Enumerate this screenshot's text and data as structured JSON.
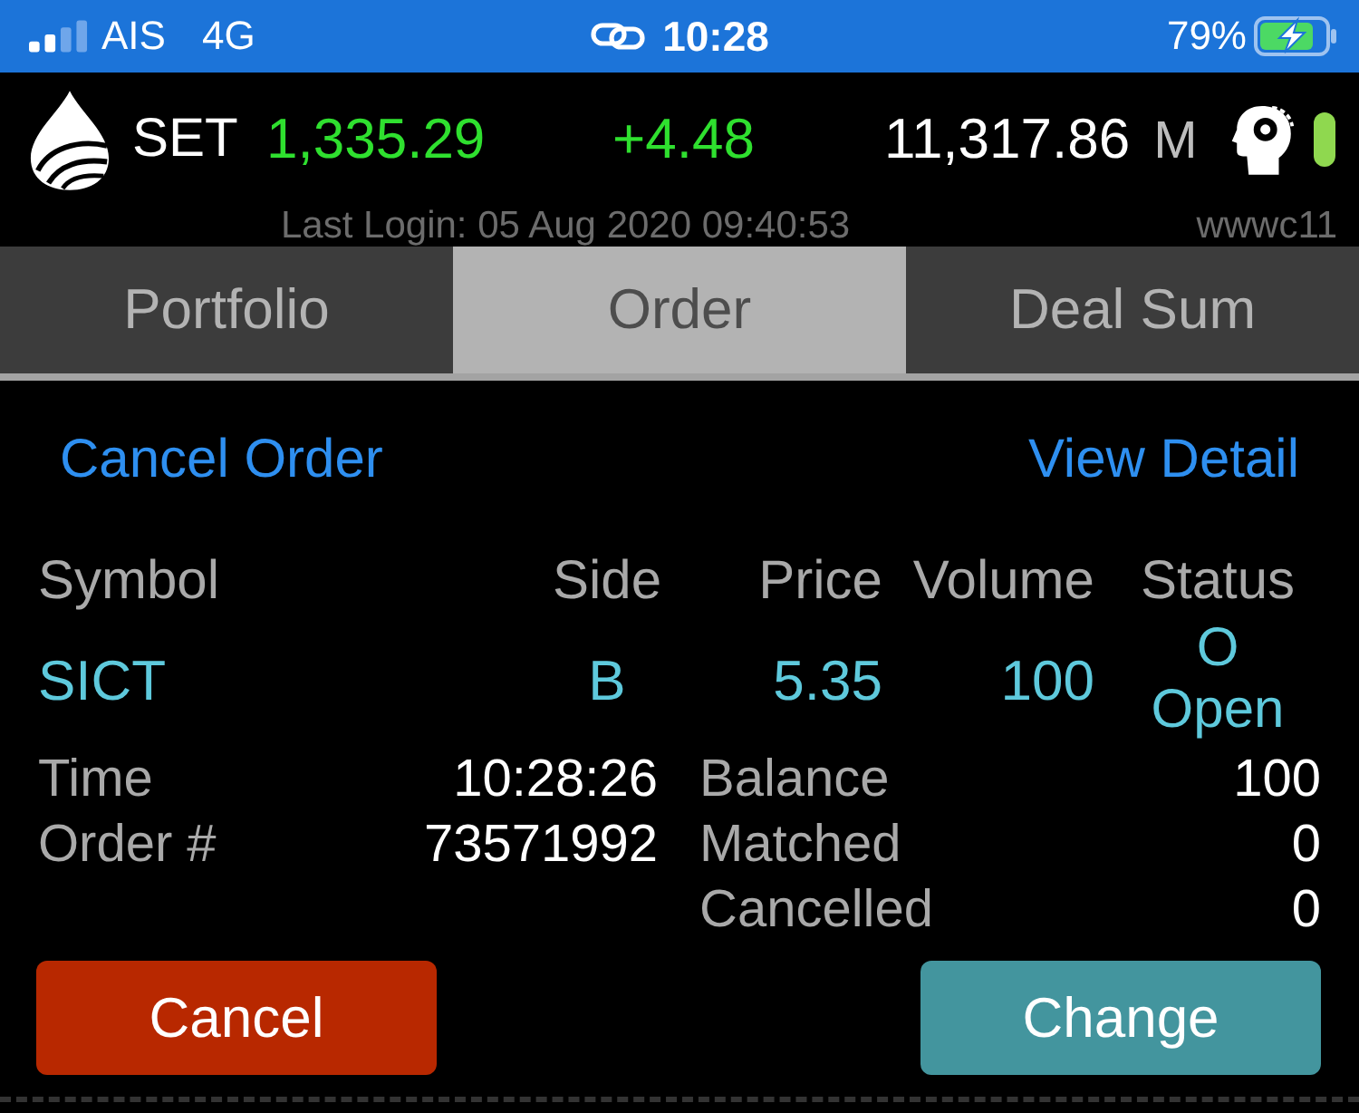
{
  "status_bar": {
    "carrier": "AIS",
    "network": "4G",
    "time": "10:28",
    "battery": "79%",
    "charging": true
  },
  "header": {
    "index_name": "SET",
    "index_value": "1,335.29",
    "change": "+4.48",
    "value": "11,317.86",
    "value_unit": "M",
    "connected": true,
    "last_login": "Last Login: 05 Aug 2020 09:40:53",
    "user": "wwwc11"
  },
  "tabs": [
    {
      "label": "Portfolio",
      "selected": false
    },
    {
      "label": "Order",
      "selected": true
    },
    {
      "label": "Deal Sum",
      "selected": false
    }
  ],
  "links": [
    "Cancel Order",
    "View Detail"
  ],
  "order_table": {
    "columns": [
      "Symbol",
      "Side",
      "Price",
      "Volume",
      "Status"
    ],
    "row": {
      "symbol": "SICT",
      "side": "B",
      "price": "5.35",
      "volume": "100",
      "status_code": "O",
      "status": "Open"
    }
  },
  "details": {
    "left": [
      {
        "label": "Time",
        "value": "10:28:26"
      },
      {
        "label": "Order #",
        "value": "73571992"
      }
    ],
    "right": [
      {
        "label": "Balance",
        "value": "100"
      },
      {
        "label": "Matched",
        "value": "0"
      },
      {
        "label": "Cancelled",
        "value": "0"
      }
    ]
  },
  "buttons": [
    {
      "label": "Cancel",
      "kind": "danger"
    },
    {
      "label": "Change",
      "kind": "primary"
    }
  ]
}
